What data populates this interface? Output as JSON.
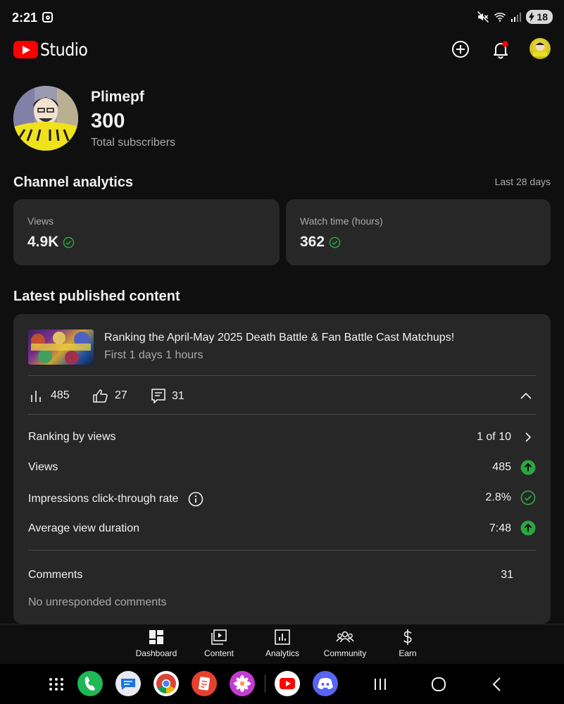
{
  "status_bar": {
    "time": "2:21",
    "battery": "18"
  },
  "app": {
    "logo_text": "Studio"
  },
  "channel": {
    "name": "Plimepf",
    "subscribers": "300",
    "subscribers_label": "Total subscribers"
  },
  "analytics": {
    "title": "Channel analytics",
    "period": "Last 28 days",
    "cards": [
      {
        "label": "Views",
        "value": "4.9K",
        "status_icon": "check-circle-icon"
      },
      {
        "label": "Watch time (hours)",
        "value": "362",
        "status_icon": "check-circle-icon"
      }
    ]
  },
  "latest": {
    "title": "Latest published content",
    "video_title": "Ranking the April-May 2025 Death Battle & Fan Battle Cast Matchups!",
    "video_sub": "First 1 days 1 hours",
    "metrics": {
      "views": "485",
      "likes": "27",
      "comments": "31"
    },
    "rows": [
      {
        "label": "Ranking by views",
        "value": "1 of 10",
        "icon": "chevron-right-icon"
      },
      {
        "label": "Views",
        "value": "485",
        "icon": "arrow-up-circle-icon"
      },
      {
        "label": "Impressions click-through rate",
        "value": "2.8%",
        "icon": "check-circle-icon"
      },
      {
        "label": "Average view duration",
        "value": "7:48",
        "icon": "arrow-up-circle-icon"
      }
    ],
    "comments_label": "Comments",
    "comments_value": "31",
    "no_unresponded": "No unresponded comments"
  },
  "bottom_nav": [
    {
      "label": "Dashboard",
      "icon": "dashboard-icon"
    },
    {
      "label": "Content",
      "icon": "content-icon"
    },
    {
      "label": "Analytics",
      "icon": "analytics-icon"
    },
    {
      "label": "Community",
      "icon": "community-icon"
    },
    {
      "label": "Earn",
      "icon": "dollar-icon"
    }
  ],
  "colors": {
    "background": "#0f0f0f",
    "card": "#272727",
    "accent_red": "#ff0000",
    "positive_green": "#2ba640",
    "secondary_text": "#aaaaaa"
  }
}
